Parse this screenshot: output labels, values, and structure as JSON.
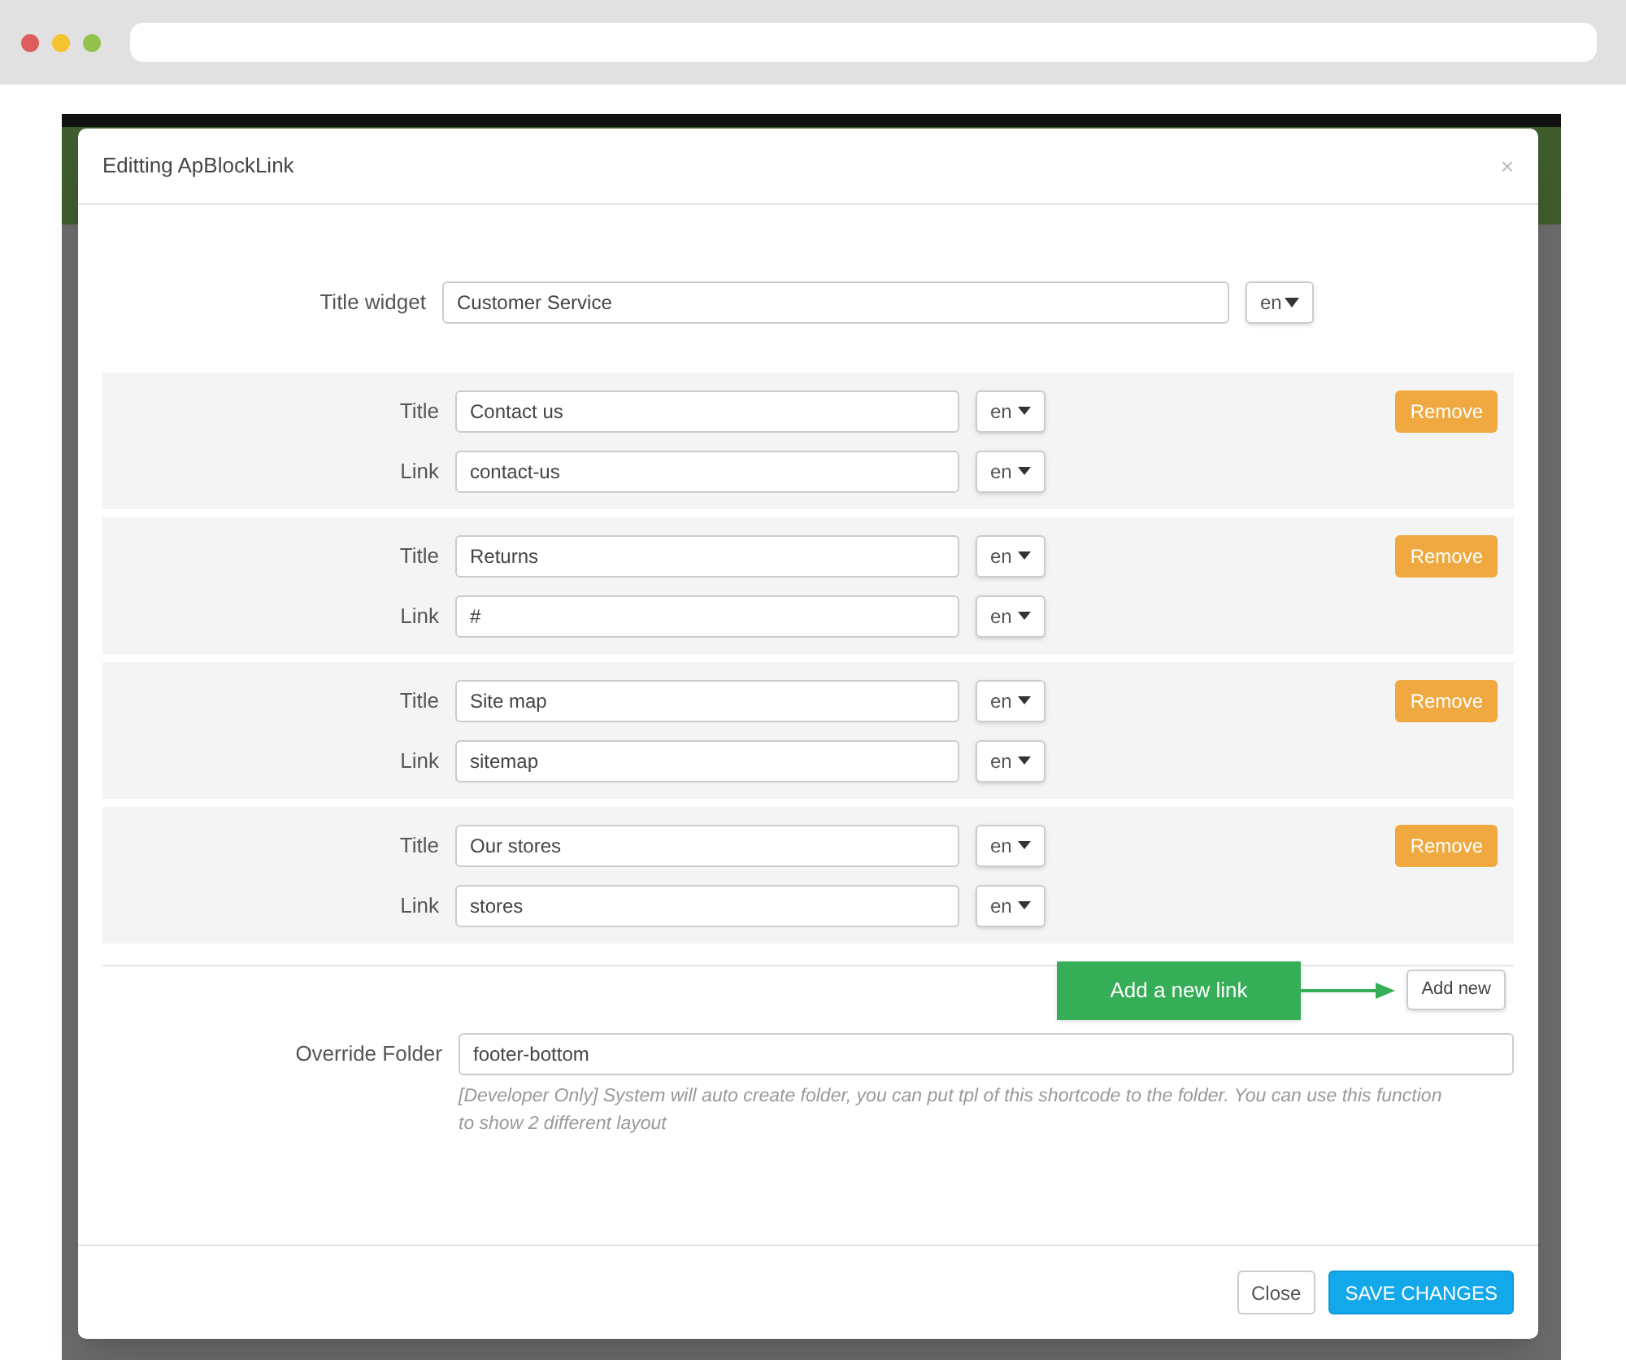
{
  "modal": {
    "title": "Editting ApBlockLink",
    "close": "×"
  },
  "title_widget": {
    "label": "Title widget",
    "value": "Customer Service",
    "language": "en"
  },
  "links": [
    {
      "title_label": "Title",
      "title": "Contact us",
      "title_language": "en",
      "link_label": "Link",
      "link": "contact-us",
      "link_language": "en",
      "remove": "Remove"
    },
    {
      "title_label": "Title",
      "title": "Returns",
      "title_language": "en",
      "link_label": "Link",
      "link": "#",
      "link_language": "en",
      "remove": "Remove"
    },
    {
      "title_label": "Title",
      "title": "Site map",
      "title_language": "en",
      "link_label": "Link",
      "link": "sitemap",
      "link_language": "en",
      "remove": "Remove"
    },
    {
      "title_label": "Title",
      "title": "Our stores",
      "title_language": "en",
      "link_label": "Link",
      "link": "stores",
      "link_language": "en",
      "remove": "Remove"
    }
  ],
  "add_new": {
    "callout": "Add a new link",
    "button": "Add new"
  },
  "override_folder": {
    "label": "Override Folder",
    "value": "footer-bottom",
    "help": "[Developer Only] System will auto create folder, you can put tpl of this shortcode to the folder. You can use this function to show 2 different layout"
  },
  "footer": {
    "close": "Close",
    "save": "SAVE CHANGES"
  }
}
